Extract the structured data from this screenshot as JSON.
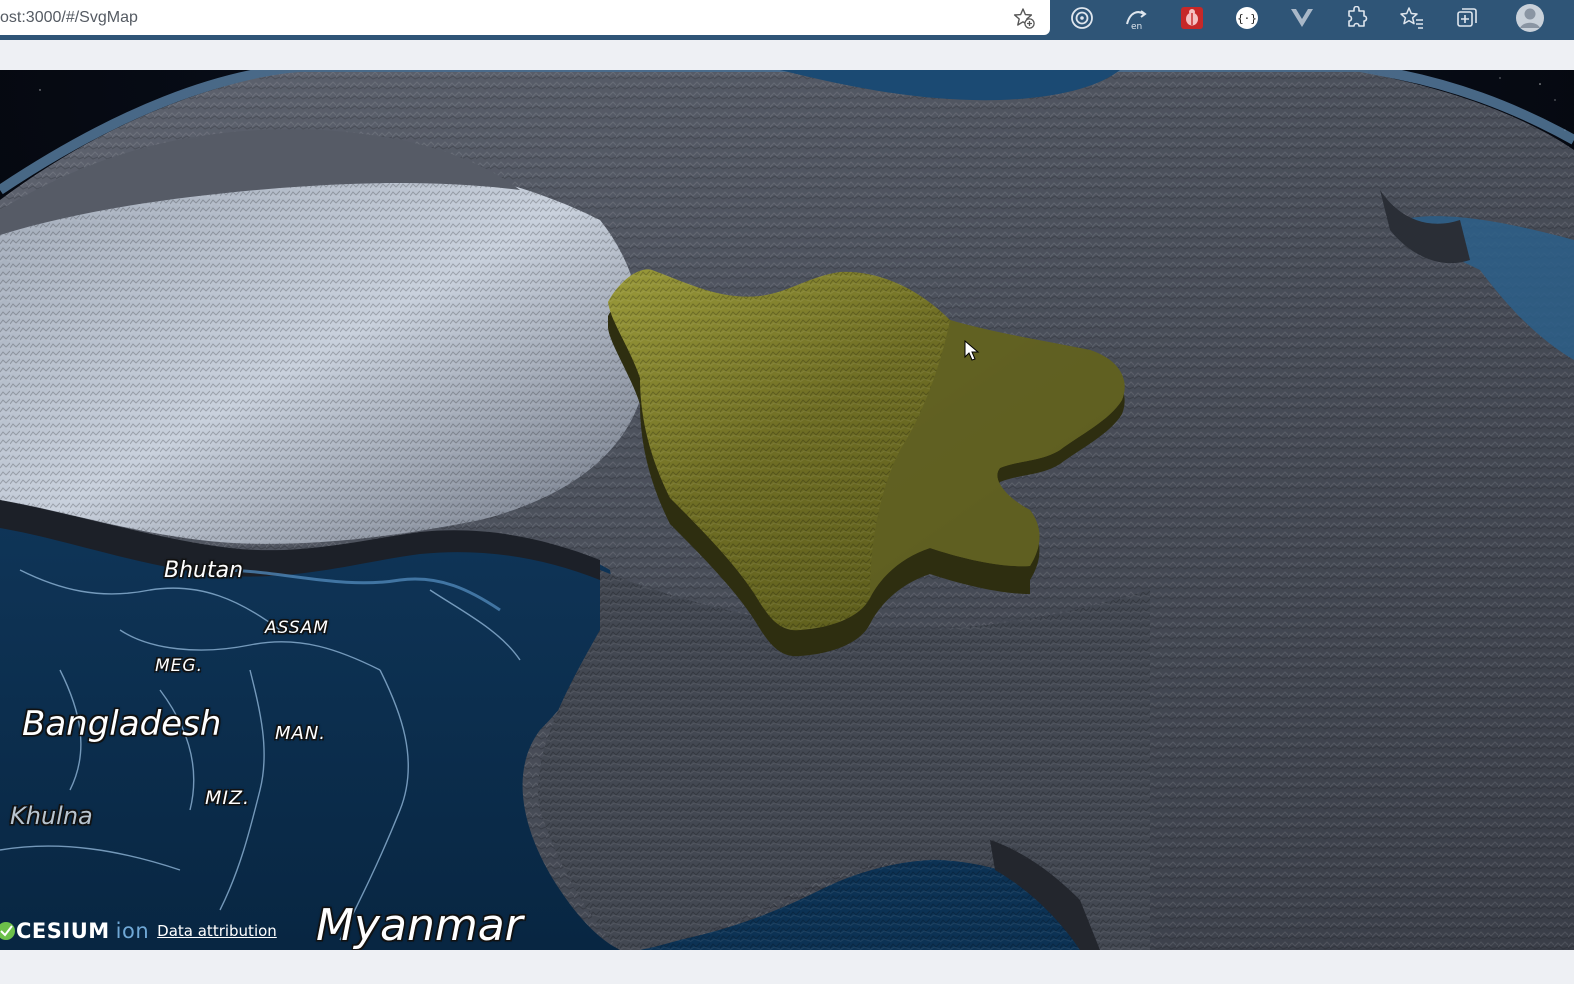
{
  "browser": {
    "url": "ost:3000/#/SvgMap",
    "extensions": [
      {
        "name": "target-icon"
      },
      {
        "name": "translate-icon"
      },
      {
        "name": "bug-extension-icon"
      },
      {
        "name": "braces-extension-icon"
      },
      {
        "name": "vue-devtools-icon"
      },
      {
        "name": "puzzle-extensions-icon"
      },
      {
        "name": "favorites-icon"
      },
      {
        "name": "collections-icon"
      }
    ]
  },
  "map": {
    "labels": {
      "bhutan": "Bhutan",
      "assam": "ASSAM",
      "meg": "MEG.",
      "bangladesh": "Bangladesh",
      "man": "MAN.",
      "miz": "MIZ.",
      "khulna": "Khulna",
      "myanmar": "Myanmar"
    },
    "highlight_color": "#8a8a2e"
  },
  "credits": {
    "logo_text": "CESIUM",
    "logo_suffix": "ion",
    "attribution": "Data attribution"
  }
}
